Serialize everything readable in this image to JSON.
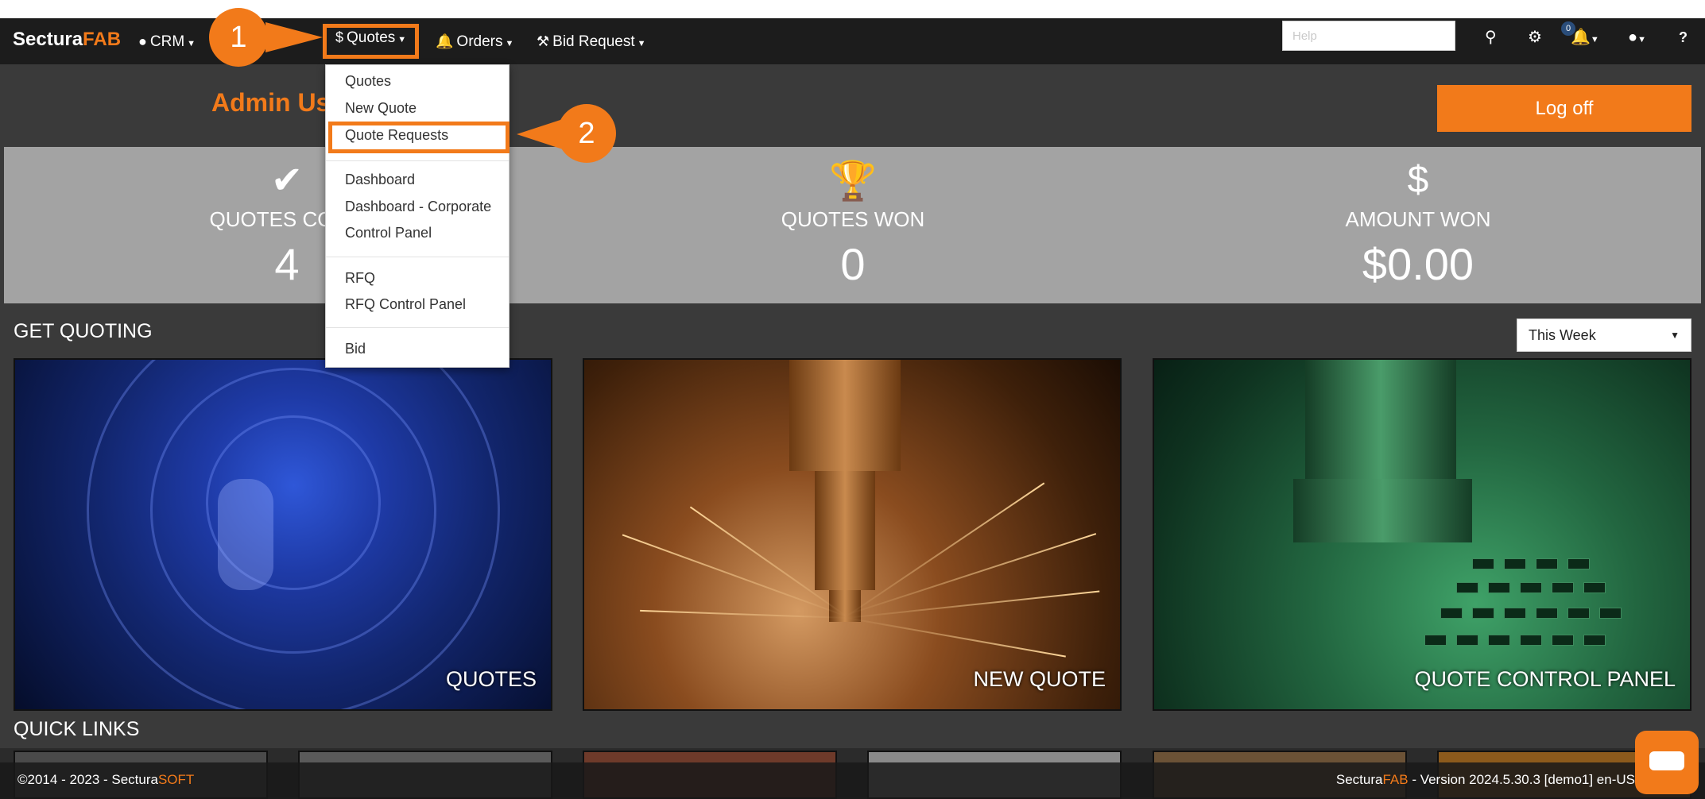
{
  "brand": {
    "part1": "Sectura",
    "part2": "FAB"
  },
  "nav": {
    "crm": "CRM",
    "quotes": "Quotes",
    "orders": "Orders",
    "bid_request": "Bid Request",
    "help_placeholder": "Help",
    "notification_count": "0"
  },
  "quotes_menu": {
    "items": [
      "Quotes",
      "New Quote",
      "Quote Requests",
      "Dashboard",
      "Dashboard - Corporate",
      "Control Panel",
      "RFQ",
      "RFQ Control Panel",
      "Bid"
    ],
    "highlighted": "Quote Requests"
  },
  "header": {
    "title": "Admin Us",
    "logoff": "Log off"
  },
  "stats": [
    {
      "label": "QUOTES COMP",
      "value": "4",
      "icon": "check-icon"
    },
    {
      "label": "QUOTES WON",
      "value": "0",
      "icon": "trophy-icon"
    },
    {
      "label": "AMOUNT WON",
      "value": "$0.00",
      "icon": "dollar-icon"
    }
  ],
  "get_quoting": {
    "title": "GET QUOTING",
    "period": "This Week",
    "tiles": [
      "QUOTES",
      "NEW QUOTE",
      "QUOTE CONTROL PANEL"
    ]
  },
  "quick_links": {
    "title": "QUICK LINKS"
  },
  "footer": {
    "copyright": "©2014 - 2023 - Sectura",
    "copyright_brand": "SOFT",
    "version_brand1": "Sectura",
    "version_brand2": "FAB",
    "version": " - Version 2024.5.30.3 [demo1] en-US"
  },
  "callouts": {
    "one": "1",
    "two": "2"
  },
  "colors": {
    "accent": "#f27a1a",
    "navbar": "#1c1c1c",
    "stats_band": "#a3a3a3"
  }
}
